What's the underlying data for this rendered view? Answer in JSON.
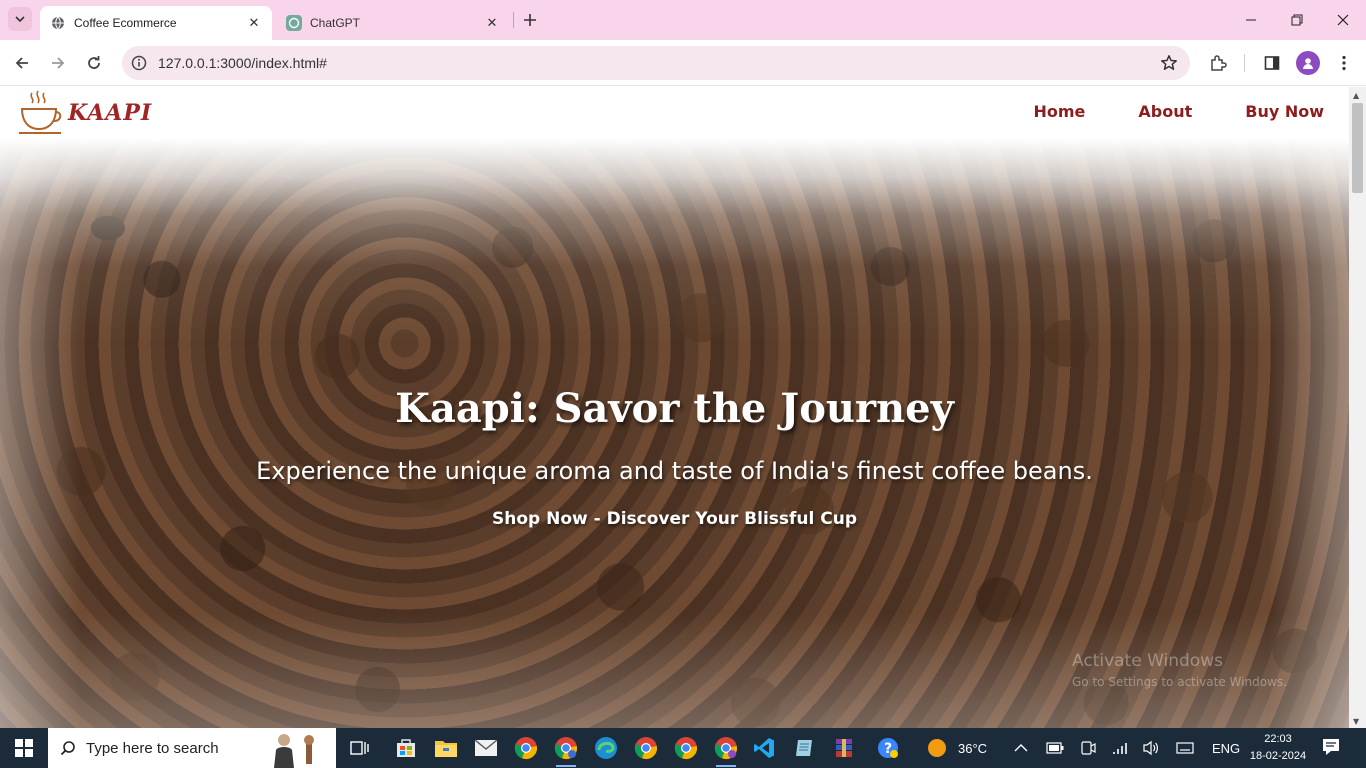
{
  "browser": {
    "tabs": [
      {
        "title": "Coffee Ecommerce",
        "active": true
      },
      {
        "title": "ChatGPT",
        "active": false
      }
    ],
    "url": "127.0.0.1:3000/index.html#"
  },
  "site": {
    "logo_text": "KAAPI",
    "nav": [
      "Home",
      "About",
      "Buy Now"
    ],
    "hero": {
      "title": "Kaapi: Savor the Journey",
      "subtitle": "Experience the unique aroma and taste of India's finest coffee beans.",
      "cta": "Shop Now - Discover Your Blissful Cup"
    },
    "watermark": {
      "line1": "Activate Windows",
      "line2": "Go to Settings to activate Windows."
    }
  },
  "taskbar": {
    "search_placeholder": "Type here to search",
    "weather": "36°C",
    "language": "ENG",
    "time": "22:03",
    "date": "18-02-2024"
  },
  "colors": {
    "tabbar": "#f8d5ea",
    "brand_red": "#a12525",
    "nav_red": "#8e1d1d",
    "taskbar": "#1c2b3a"
  }
}
